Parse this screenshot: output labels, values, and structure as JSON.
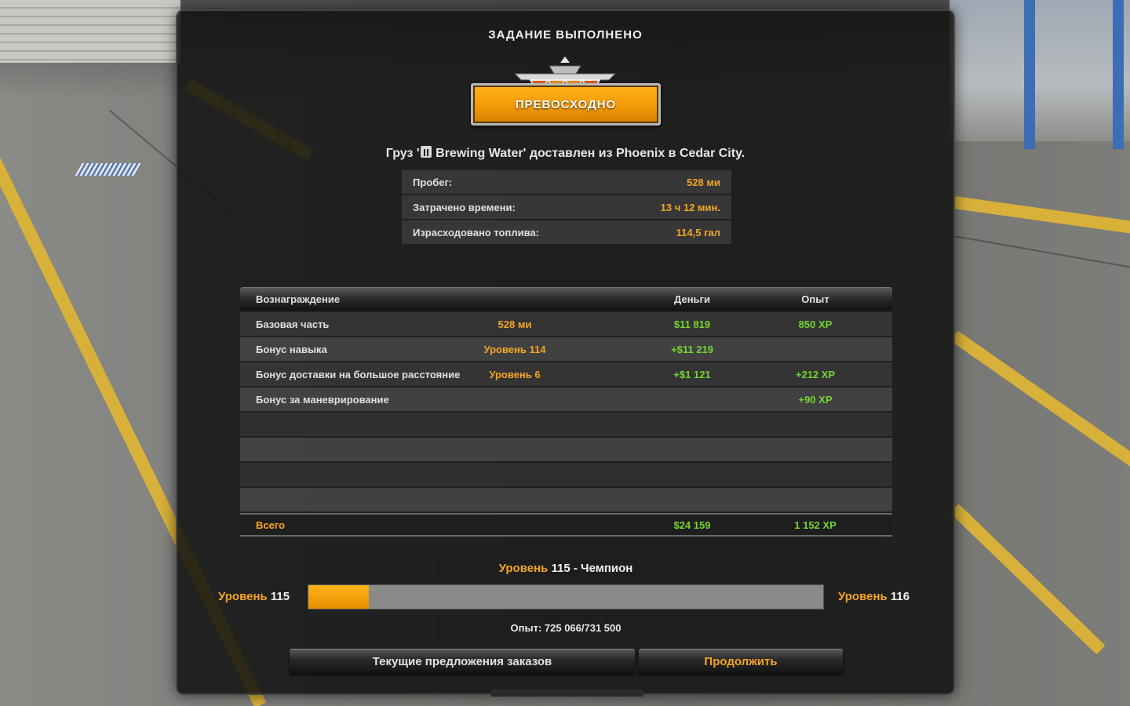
{
  "window": {
    "title": "ЗАДАНИЕ ВЫПОЛНЕНО"
  },
  "rating": {
    "label": "ПРЕВОСХОДНО",
    "color": "#f39a05"
  },
  "cargo": {
    "prefix": "Груз '",
    "name": "Brewing Water",
    "suffix": "' доставлен из Phoenix в Cedar City.",
    "icon": "cargo-crate-icon"
  },
  "stats": [
    {
      "label": "Пробег:",
      "value": "528 ми"
    },
    {
      "label": "Затрачено времени:",
      "value": "13 ч 12 мин."
    },
    {
      "label": "Израсходовано топлива:",
      "value": "114,5 гал"
    }
  ],
  "rewards": {
    "headers": {
      "name": "Вознаграждение",
      "money": "Деньги",
      "xp": "Опыт"
    },
    "rows": [
      {
        "name": "Базовая часть",
        "extra": "528 ми",
        "money": "$11 819",
        "xp": "850 XP"
      },
      {
        "name": "Бонус навыка",
        "extra": "Уровень 114",
        "money": "+$11 219",
        "xp": ""
      },
      {
        "name": "Бонус доставки на большое расстояние",
        "extra": "Уровень 6",
        "money": "+$1 121",
        "xp": "+212 XP"
      },
      {
        "name": "Бонус за маневрирование",
        "extra": "",
        "money": "",
        "xp": "+90 XP"
      }
    ],
    "total": {
      "name": "Всего",
      "money": "$24 159",
      "xp": "1 152 XP"
    }
  },
  "level": {
    "title_word": "Уровень",
    "title_rest": "115 - Чемпион",
    "current_word": "Уровень",
    "current_num": "115",
    "next_word": "Уровень",
    "next_num": "116",
    "progress": 0.118,
    "xp_text": "Опыт: 725 066/731 500"
  },
  "buttons": {
    "offers": "Текущие предложения заказов",
    "continue": "Продолжить"
  },
  "colors": {
    "accent": "#f5a623",
    "money": "#75d530",
    "panel": "#121212"
  }
}
